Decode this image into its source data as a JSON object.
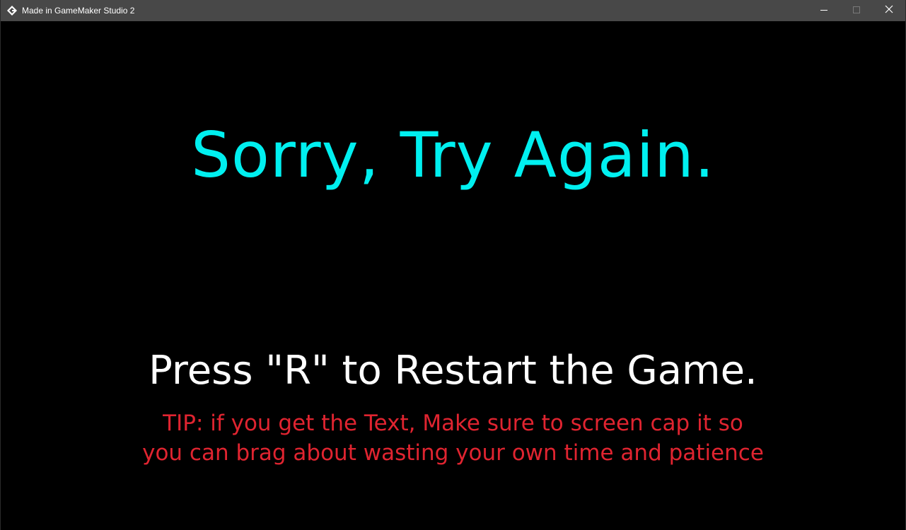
{
  "window": {
    "title": "Made in GameMaker Studio 2",
    "app_icon": "gamemaker-icon",
    "controls": {
      "minimize_icon": "minimize-icon",
      "maximize_icon": "maximize-icon",
      "close_icon": "close-icon"
    }
  },
  "game": {
    "headline": "Sorry, Try Again.",
    "restart_prompt": "Press \"R\" to Restart the Game.",
    "tip_line1": "TIP: if you get the Text, Make sure to screen cap it so",
    "tip_line2": "you can brag about wasting your own time and patience"
  },
  "colors": {
    "background": "#000000",
    "titlebar": "#484848",
    "headline": "#00f0f0",
    "restart_prompt": "#ffffff",
    "tip": "#e02430"
  }
}
